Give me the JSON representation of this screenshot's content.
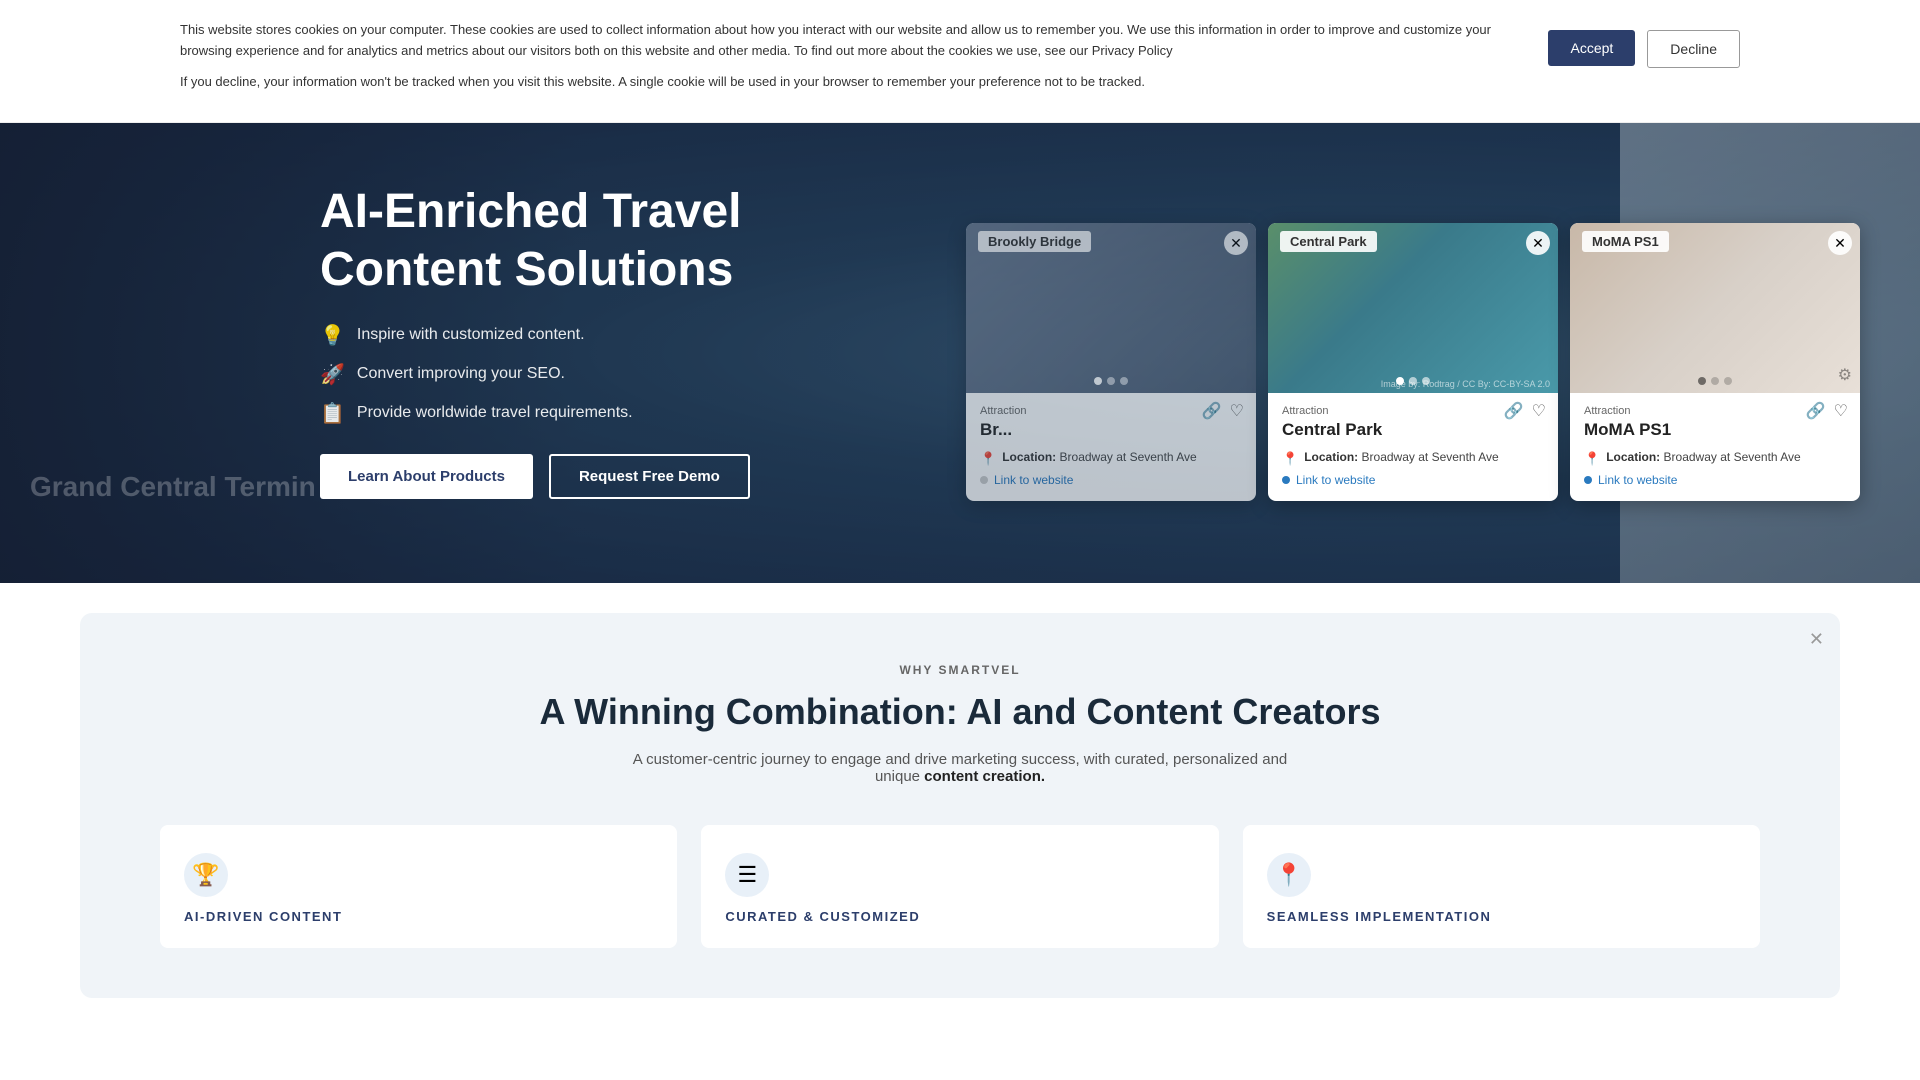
{
  "cookie": {
    "paragraph1": "This website stores cookies on your computer. These cookies are used to collect information about how you interact with our website and allow us to remember you. We use this information in order to improve and customize your browsing experience and for analytics and metrics about our visitors both on this website and other media. To find out more about the cookies we use, see our Privacy Policy",
    "paragraph2": "If you decline, your information won't be tracked when you visit this website. A single cookie will be used in your browser to remember your preference not to be tracked.",
    "accept_label": "Accept",
    "decline_label": "Decline"
  },
  "hero": {
    "title": "AI-Enriched Travel Content Solutions",
    "features": [
      {
        "icon": "💡",
        "text": "Inspire with customized content."
      },
      {
        "icon": "🚀",
        "text": "Convert improving your SEO."
      },
      {
        "icon": "📋",
        "text": "Provide worldwide travel requirements."
      }
    ],
    "btn_learn": "Learn About Products",
    "btn_demo": "Request Free Demo",
    "bg_text_line1": "Grand Central Termin",
    "attribution": "Image by: Rodtrag / CC By: CC-BY-SA 2.0"
  },
  "cards": {
    "brooklyn_bridge": {
      "title": "Brookly Bridge",
      "category": "Attraction",
      "name": "Br...",
      "location_label": "Location:",
      "location_value": "Broadway at Seventh Ave",
      "link_text": "Link to website"
    },
    "central_park": {
      "title": "Central Park",
      "category": "Attraction",
      "name": "Central Park",
      "location_label": "Location:",
      "location_value": "Broadway at Seventh Ave",
      "link_text": "Link to website"
    },
    "moma": {
      "title": "MoMA PS1",
      "category": "Attraction",
      "name": "MoMA PS1",
      "location_label": "Location:",
      "location_value": "Broadway at Seventh Ave",
      "link_text": "Link to website"
    }
  },
  "why_section": {
    "subtitle": "WHY SMARTVEL",
    "title": "A Winning Combination: AI and Content Creators",
    "description_before": "A customer-centric journey to engage and drive marketing success, with curated, personalized and unique ",
    "description_strong": "content creation.",
    "features": [
      {
        "icon": "🏆",
        "title": "AI-DRIVEN CONTENT"
      },
      {
        "icon": "☰",
        "title": "CURATED & CUSTOMIZED"
      },
      {
        "icon": "📍",
        "title": "SEAMLESS IMPLEMENTATION"
      }
    ]
  }
}
